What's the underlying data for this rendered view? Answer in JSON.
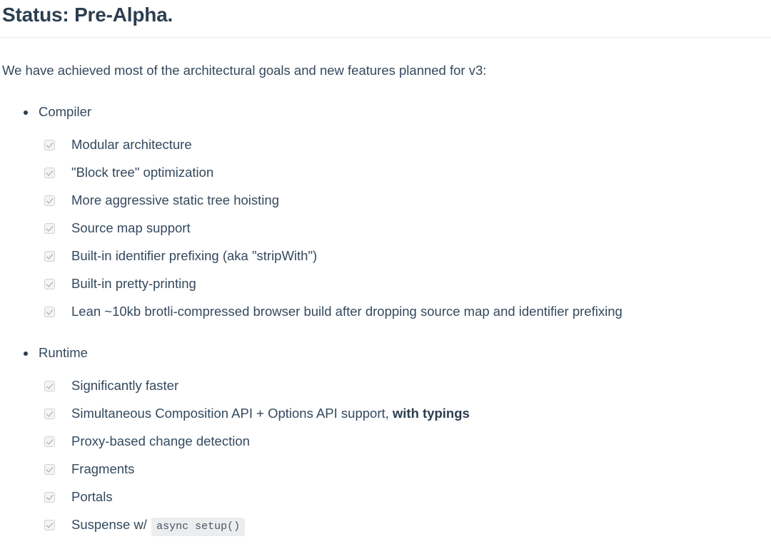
{
  "page": {
    "title": "Status: Pre-Alpha.",
    "intro": "We have achieved most of the architectural goals and new features planned for v3:"
  },
  "colors": {
    "text": "#34495e",
    "heading": "#2c3e50",
    "rule": "#eaecef",
    "checkbox_fill": "#f3f4f5",
    "checkbox_border": "#cfd3d7",
    "checkbox_mark": "#9ea4aa",
    "code_background": "#ebedef",
    "background": "#ffffff"
  },
  "groups": [
    {
      "label": "Compiler",
      "bullet_icon": "disc-bullet-icon",
      "items": [
        {
          "checked": true,
          "text": "Modular architecture"
        },
        {
          "checked": true,
          "text": "\"Block tree\" optimization"
        },
        {
          "checked": true,
          "text": "More aggressive static tree hoisting"
        },
        {
          "checked": true,
          "text": "Source map support"
        },
        {
          "checked": true,
          "text": "Built-in identifier prefixing (aka \"stripWith\")"
        },
        {
          "checked": true,
          "text": "Built-in pretty-printing"
        },
        {
          "checked": true,
          "text": "Lean ~10kb brotli-compressed browser build after dropping source map and identifier prefixing"
        }
      ]
    },
    {
      "label": "Runtime",
      "bullet_icon": "disc-bullet-icon",
      "items": [
        {
          "checked": true,
          "text": "Significantly faster"
        },
        {
          "checked": true,
          "text": "Simultaneous Composition API + Options API support, ",
          "bold_text": "with typings"
        },
        {
          "checked": true,
          "text": "Proxy-based change detection"
        },
        {
          "checked": true,
          "text": "Fragments"
        },
        {
          "checked": true,
          "text": "Portals"
        },
        {
          "checked": true,
          "text": "Suspense w/ ",
          "code_text": "async setup()"
        }
      ]
    }
  ]
}
